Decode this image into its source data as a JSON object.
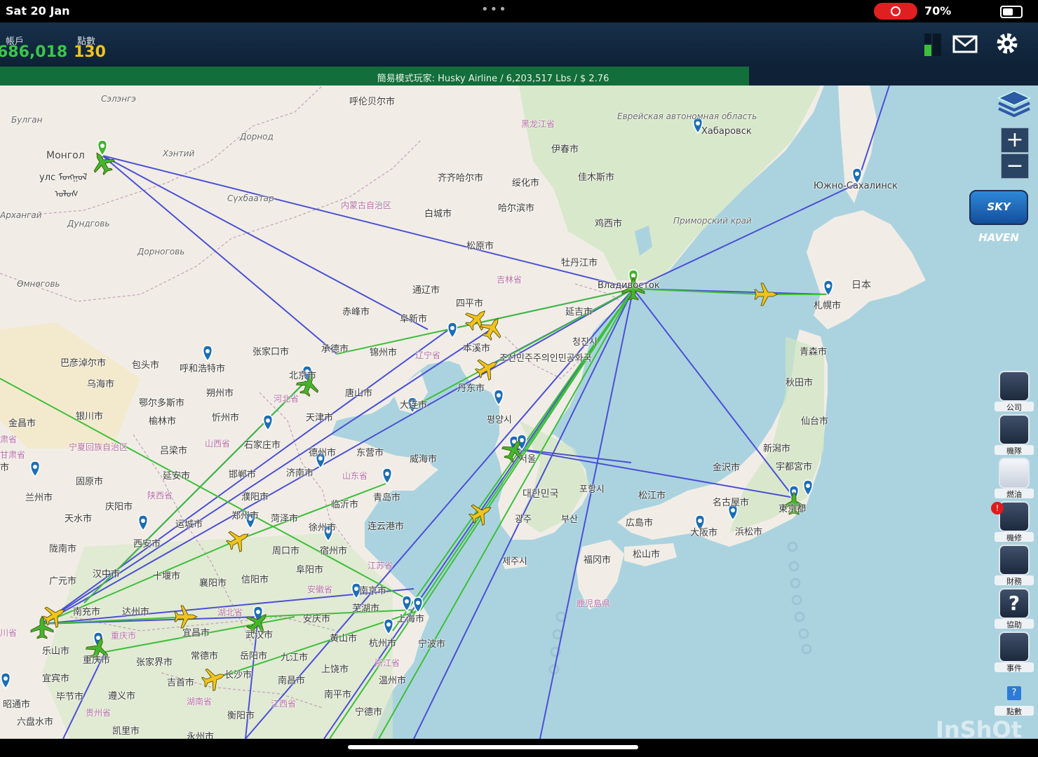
{
  "status_bar": {
    "date": "Sat 20 Jan",
    "battery": "70%",
    "battery_level": 0.7
  },
  "header": {
    "account_label": "帳戶",
    "account_value": "686,018",
    "points_label": "點數",
    "points_value": "130"
  },
  "ticker": {
    "text": "簡易模式玩家: Husky Airline / 6,203,517 Lbs / $ 2.76"
  },
  "map_labels": {
    "hulunbuir": "呼伦贝尔市",
    "heilongjiang": "黑龙江省",
    "yichun": "伊春市",
    "jiamusi": "佳木斯市",
    "khabarovsk": "Хабаровск",
    "jewish_ao": "Еврейская автономная область",
    "yuzhno": "Южно-Сахалинск",
    "mongol": "Монгол",
    "mongol2": "улс ᠮᠣᠩᠭᠣᠯ",
    "mongol3": "ᠤᠯᠤᠰ",
    "bulgan": "Булган",
    "selenge": "Сэлэнгэ",
    "khentii": "Хэнтий",
    "dornod": "Дорнод",
    "sukhbaatar": "Сүхбаатар",
    "arkhangai": "Архангай",
    "dundgovi": "Дундговь",
    "dornogovi": "Дорноговь",
    "omnogovi": "Өмнөговь",
    "inner_mongolia": "内蒙古自治区",
    "qiqihar": "齐齐哈尔市",
    "suihua": "绥化市",
    "harbin": "哈尔滨市",
    "baicheng": "白城市",
    "songyuan": "松原市",
    "jixi": "鸡西市",
    "mudanjiang": "牡丹江市",
    "primorsky": "Приморский край",
    "vlad": "Владивосток",
    "japan": "日本",
    "sapporo": "札幌市",
    "jilin": "吉林省",
    "tongliao": "通辽市",
    "siping": "四平市",
    "chifeng": "赤峰市",
    "fuxin": "阜新市",
    "yanji": "延吉市",
    "chongjin": "청진시",
    "dprk": "조선민주주의인민공화국",
    "benxi": "本溪市",
    "chengde": "承德市",
    "jinzhou": "锦州市",
    "liaoning": "辽宁省",
    "dandong": "丹东市",
    "pyongyang": "평양시",
    "zhangjiakou": "张家口市",
    "beijing": "北京市",
    "hebei": "河北省",
    "tianjin": "天津市",
    "tangshan": "唐山市",
    "dalian": "大连市",
    "bayannur": "巴彦淖尔市",
    "baotou": "包头市",
    "hohhot": "呼和浩特市",
    "wuhai": "乌海市",
    "ordos": "鄂尔多斯市",
    "shuozhou": "朔州市",
    "xinzhou": "忻州市",
    "yinchuan": "银川市",
    "yulin": "榆林市",
    "jinchang": "金昌市",
    "ningxia": "宁夏回族自治区",
    "gansu": "肃省",
    "lvliang": "吕梁市",
    "shanxi": "山西省",
    "shijiazhuang": "石家庄市",
    "dezhou": "德州市",
    "dongying": "东营市",
    "weihai": "威海市",
    "qingdao": "青岛市",
    "shandong": "山东省",
    "jinan": "济南市",
    "handan": "邯郸市",
    "yanan": "延安市",
    "guyuan": "固原市",
    "lanzhou": "兰州市",
    "qingyang": "庆阳市",
    "shaanxi": "陕西省",
    "puyang": "濮阳市",
    "zhengzhou": "郑州市",
    "heze": "菏泽市",
    "linyi": "临沂市",
    "lianyungang": "连云港市",
    "xuzhou": "徐州市",
    "yuncheng": "运城市",
    "tianshui": "天水市",
    "xian": "西安市",
    "zhoukou": "周口市",
    "suzhou": "宿州市",
    "fuyang": "阜阳市",
    "jiangsu": "江苏省",
    "longnan": "陇南市",
    "hanzhong": "汉中市",
    "shiyan": "十堰市",
    "xiangyang": "襄阳市",
    "xinyang": "信阳市",
    "guangyuan": "广元市",
    "anhui": "安徽省",
    "nanjing": "南京市",
    "nanchong": "南充市",
    "dazhou": "达州市",
    "hubei": "湖北省",
    "yichang": "宜昌市",
    "wuhan": "武汉市",
    "anqing": "安庆市",
    "wuhu": "芜湖市",
    "shanghai": "上海市",
    "huangshan": "黄山市",
    "hangzhou": "杭州市",
    "ningbo": "宁波市",
    "zhejiang": "浙江省",
    "wenzhou": "温州市",
    "chongqing_city": "重庆市",
    "chongqing": "重庆市",
    "zhangjiajie": "张家界市",
    "changde": "常德市",
    "yueyang": "岳阳市",
    "jiujiang": "九江市",
    "jingdezhen": "上饶市",
    "nanchang": "南昌市",
    "jiangxi": "江西省",
    "nanping": "南平市",
    "ningde": "宁德市",
    "leshan": "乐山市",
    "yibin": "宜宾市",
    "bijie": "毕节市",
    "zunyi": "遵义市",
    "jishou": "吉首市",
    "changsha": "长沙市",
    "hunan": "湖南省",
    "hengyang": "衡阳市",
    "zhaotong": "昭通市",
    "liupanshui": "六盘水市",
    "guizhou": "贵州省",
    "kaili": "凯里市",
    "yongzhou": "永州市",
    "sichuan": "川省",
    "seoul": "서울",
    "korea": "대한민국",
    "pohang": "포항시",
    "gwangju": "광주",
    "busan": "부산",
    "jeju": "제주시",
    "fukuoka": "福冈市",
    "kagoshima": "鹿児島県",
    "hiroshima": "広島市",
    "matsuyama": "松山市",
    "osaka": "大阪市",
    "matsue": "松江市",
    "nagoya": "名古屋市",
    "hamamatsu": "浜松市",
    "kanazawa": "金沢市",
    "niigata": "新潟市",
    "utsunomiya": "宇都宮市",
    "tokyo": "東京都",
    "sendai": "仙台市",
    "akita": "秋田市",
    "aomori": "青森市",
    "shu": "市",
    "gansu2": "甘肃省"
  },
  "side_menu": {
    "company": "公司",
    "fleet": "機隊",
    "fuel": "燃油",
    "maintenance": "機修",
    "finance": "財務",
    "help": "協助",
    "events": "事件",
    "points": "點數"
  },
  "maintenance_badge": "!",
  "skyhaven": "SKY HAVEN",
  "zoom_in": "+",
  "zoom_out": "−",
  "watermark": "InShOt",
  "colors": {
    "route_blue": "#4b4fd6",
    "route_green": "#3dbf3a",
    "plane_green": "#43b52f",
    "plane_yellow": "#f2c21e",
    "pin_blue": "#1c6eb5",
    "ticker_green": "#126e3a"
  },
  "icons": {
    "mail": "mail-icon",
    "settings": "gear-icon",
    "layers": "layers-icon",
    "signal": "signal-bars-icon"
  }
}
